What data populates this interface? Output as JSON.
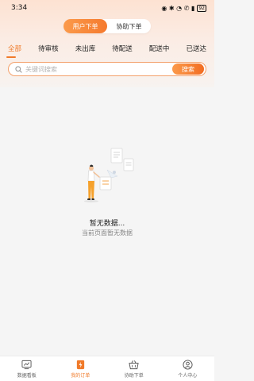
{
  "status_bar": {
    "time": "3:34",
    "icons_text": "◉ ✱ ◔ ✆ ▮",
    "battery": "92"
  },
  "header": {
    "toggle": [
      {
        "label": "用户下单",
        "active": true
      },
      {
        "label": "协助下单",
        "active": false
      }
    ],
    "tabs": [
      {
        "label": "全部",
        "active": true
      },
      {
        "label": "待审核"
      },
      {
        "label": "未出库"
      },
      {
        "label": "待配送"
      },
      {
        "label": "配送中"
      },
      {
        "label": "已送达"
      }
    ]
  },
  "search": {
    "placeholder": "关键词搜索",
    "button_label": "搜索"
  },
  "empty_state": {
    "title": "暂无数据...",
    "subtitle": "当前页面暂无数据"
  },
  "bottom_nav": [
    {
      "label": "数据看板",
      "icon": "dashboard-icon"
    },
    {
      "label": "我的订单",
      "icon": "order-icon",
      "active": true
    },
    {
      "label": "协助下单",
      "icon": "basket-icon"
    },
    {
      "label": "个人中心",
      "icon": "user-icon"
    }
  ],
  "colors": {
    "accent": "#f07a2a",
    "accent_light": "#fb9a4b",
    "background": "#f5f5f5"
  }
}
